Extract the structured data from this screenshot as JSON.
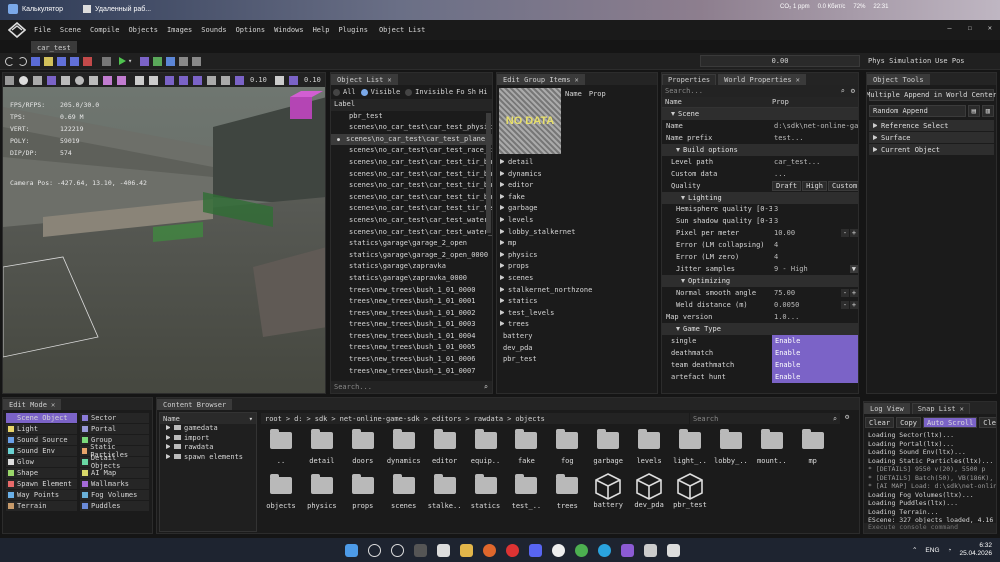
{
  "browser_tabs": [
    {
      "label": "Калькулятор"
    },
    {
      "label": "Удаленный раб..."
    }
  ],
  "system_tray_top": [
    "CO₂ 1 ppm",
    "0.0 Кбит/с",
    "72%",
    "22:31"
  ],
  "menu": [
    "File",
    "Scene",
    "Compile",
    "Objects",
    "Images",
    "Sounds",
    "Options",
    "Windows",
    "Help",
    "Plugins",
    "Object List"
  ],
  "doc_tab": "car_test",
  "toolbar": {
    "time_value": "0.00",
    "phys_sim": "Phys Simulation",
    "use_pos": "Use Pos"
  },
  "viewport": {
    "stats": [
      {
        "k": "FPS/RFPS:",
        "v": "205.0/30.0"
      },
      {
        "k": "TPS:",
        "v": "0.69 M"
      },
      {
        "k": "VERT:",
        "v": "122219"
      },
      {
        "k": "POLY:",
        "v": "59019"
      },
      {
        "k": "DIP/DP:",
        "v": "574"
      }
    ],
    "cam": "Camera Pos: -427.64, 13.10, -406.42",
    "snap1": "0.10",
    "snap2": "0.10"
  },
  "object_list": {
    "title": "Object List",
    "filters": [
      "All",
      "Visible",
      "Invisible",
      "Fo",
      "Sh",
      "Hi"
    ],
    "header": "Label",
    "items": [
      "pbr_test",
      "scenes\\no_car_test\\car_test_physic",
      "scenes\\no_car_test\\car_test_plane",
      "scenes\\no_car_test\\car_test_race_tr",
      "scenes\\no_car_test\\car_test_tir_bui",
      "scenes\\no_car_test\\car_test_tir_bui",
      "scenes\\no_car_test\\car_test_tir_bui",
      "scenes\\no_car_test\\car_test_tir_bui",
      "scenes\\no_car_test\\car_test_tir_ter",
      "scenes\\no_car_test\\car_test_water",
      "scenes\\no_car_test\\car_test_water_0",
      "statics\\garage\\garage_2_open",
      "statics\\garage\\garage_2_open_0000",
      "statics\\garage\\zapravka",
      "statics\\garage\\zapravka_0000",
      "trees\\new_trees\\bush_1_01_0000",
      "trees\\new_trees\\bush_1_01_0001",
      "trees\\new_trees\\bush_1_01_0002",
      "trees\\new_trees\\bush_1_01_0003",
      "trees\\new_trees\\bush_1_01_0004",
      "trees\\new_trees\\bush_1_01_0005",
      "trees\\new_trees\\bush_1_01_0006",
      "trees\\new_trees\\bush_1_01_0007"
    ],
    "search": "Search..."
  },
  "group_items": {
    "title": "Edit Group Items",
    "cols": [
      "Name",
      "Prop"
    ],
    "no_data": "NO DATA",
    "items": [
      {
        "label": "detail",
        "fold": true
      },
      {
        "label": "dynamics",
        "fold": true
      },
      {
        "label": "editor",
        "fold": true
      },
      {
        "label": "fake",
        "fold": true
      },
      {
        "label": "garbage",
        "fold": true
      },
      {
        "label": "levels",
        "fold": true
      },
      {
        "label": "lobby_stalkernet",
        "fold": true
      },
      {
        "label": "mp",
        "fold": true
      },
      {
        "label": "physics",
        "fold": true
      },
      {
        "label": "props",
        "fold": true
      },
      {
        "label": "scenes",
        "fold": true
      },
      {
        "label": "stalkernet_northzone",
        "fold": true
      },
      {
        "label": "statics",
        "fold": true
      },
      {
        "label": "test_levels",
        "fold": true
      },
      {
        "label": "trees",
        "fold": true
      },
      {
        "label": "battery",
        "fold": false
      },
      {
        "label": "dev_pda",
        "fold": false
      },
      {
        "label": "pbr_test",
        "fold": false
      }
    ]
  },
  "properties": {
    "tabs": [
      "Properties",
      "World Properties"
    ],
    "search": "Search...",
    "cols": [
      "Name",
      "Prop"
    ],
    "rows": [
      {
        "t": "sect",
        "n": "Scene",
        "ind": 1
      },
      {
        "t": "kv",
        "n": "Name",
        "v": "d:\\sdk\\net-online-gam",
        "ind": 0
      },
      {
        "t": "kv",
        "n": "Name prefix",
        "v": "test...",
        "ind": 0
      },
      {
        "t": "sect",
        "n": "Build options",
        "ind": 2
      },
      {
        "t": "kv",
        "n": "Level path",
        "v": "car_test...",
        "ind": 1
      },
      {
        "t": "kv",
        "n": "Custom data",
        "v": "...",
        "ind": 1
      },
      {
        "t": "q",
        "n": "Quality",
        "v": [
          "Draft",
          "High",
          "Custom"
        ],
        "ind": 1
      },
      {
        "t": "sect",
        "n": "Lighting",
        "ind": 3
      },
      {
        "t": "kv",
        "n": "Hemisphere quality [0-3]",
        "v": "3",
        "ind": 2
      },
      {
        "t": "kv",
        "n": "Sun shadow quality [0-3]",
        "v": "3",
        "ind": 2
      },
      {
        "t": "num",
        "n": "Pixel per meter",
        "v": "10.00",
        "ind": 2
      },
      {
        "t": "kv",
        "n": "Error (LM collapsing)",
        "v": "4",
        "ind": 2
      },
      {
        "t": "kv",
        "n": "Error (LM zero)",
        "v": "4",
        "ind": 2
      },
      {
        "t": "dd",
        "n": "Jitter samples",
        "v": "9 - High",
        "ind": 2
      },
      {
        "t": "sect",
        "n": "Optimizing",
        "ind": 3
      },
      {
        "t": "num",
        "n": "Normal smooth angle",
        "v": "75.00",
        "ind": 2
      },
      {
        "t": "num",
        "n": "Weld distance (m)",
        "v": "0.0050",
        "ind": 2
      },
      {
        "t": "kv",
        "n": "Map version",
        "v": "1.0...",
        "ind": 0
      },
      {
        "t": "sect",
        "n": "Game Type",
        "ind": 2
      },
      {
        "t": "en",
        "n": "single",
        "v": "Enable",
        "ind": 1
      },
      {
        "t": "en",
        "n": "deathmatch",
        "v": "Enable",
        "ind": 1
      },
      {
        "t": "en",
        "n": "team deathmatch",
        "v": "Enable",
        "ind": 1
      },
      {
        "t": "en",
        "n": "artefact hunt",
        "v": "Enable",
        "ind": 1
      }
    ]
  },
  "object_tools": {
    "title": "Object Tools",
    "buttons": [
      "Multiple Append in World Center",
      "Random Append"
    ],
    "sections": [
      "Reference Select",
      "Surface",
      "Current Object"
    ]
  },
  "edit_mode": {
    "title": "Edit Mode",
    "left": [
      "Scene Object",
      "Light",
      "Sound Source",
      "Sound Env",
      "Glow",
      "Shape",
      "Spawn Element",
      "Way Points",
      "Terrain"
    ],
    "right": [
      "Sector",
      "Portal",
      "Group",
      "Static Particles",
      "Detail Objects",
      "AI Map",
      "Wallmarks",
      "Fog Volumes",
      "Puddles"
    ]
  },
  "content_browser": {
    "title": "Content Browser",
    "tree_header": "Name",
    "tree": [
      "gamedata",
      "import",
      "rawdata",
      "spawn elements"
    ],
    "path": [
      "root",
      ">",
      "d:",
      ">",
      "sdk",
      ">",
      "net-online-game-sdk",
      ">",
      "editors",
      ">",
      "rawdata",
      ">",
      "objects"
    ],
    "search": "Search",
    "row1": [
      "..",
      "detail",
      "doors",
      "dynamics",
      "editor",
      "equip..",
      "fake",
      "fog",
      "garbage",
      "levels",
      "light_..",
      "lobby_..",
      "mount..",
      "mp"
    ],
    "row2": [
      "objects",
      "physics",
      "props",
      "scenes",
      "stalke..",
      "statics",
      "test_..",
      "trees",
      "battery",
      "dev_pda",
      "pbr_test"
    ]
  },
  "log": {
    "tabs": [
      "Log View",
      "Snap List"
    ],
    "buttons": [
      "Clear",
      "Copy",
      "Auto Scroll",
      "Clear"
    ],
    "lines": [
      "Loading Sector(ltx)...",
      "Loading Portal(ltx)...",
      "Loading Sound Env(ltx)...",
      "Loading Static Particles(ltx)...",
      "* [DETAILS] 9550 v(20), 5500 p",
      "* [DETAILS] Batch(50), VB(186K),",
      "* [AI MAP] Load: d:\\sdk\\net-onlin",
      "Loading Fog Volumes(ltx)...",
      "Loading Puddles(ltx)...",
      "Loading Terrain...",
      "EScene: 327 objects loaded, 4.16"
    ],
    "cmd": "Execute console command"
  },
  "taskbar": {
    "lang": "ENG",
    "time": "6:32",
    "date": "25.04.2026"
  },
  "colors": {
    "accent": "#7b63c7",
    "selected": "#3b3b3b",
    "bg": "#1b1b1b"
  }
}
